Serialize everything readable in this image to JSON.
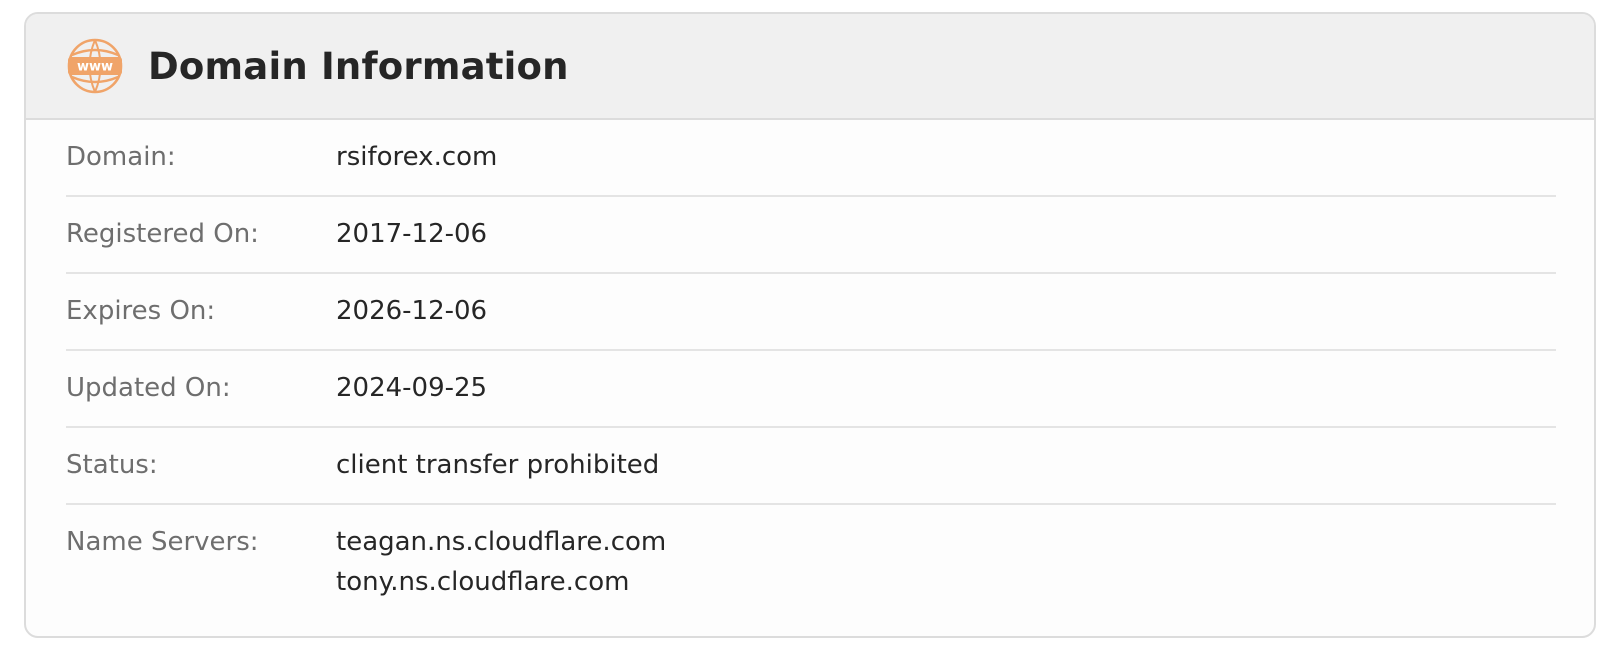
{
  "header": {
    "title": "Domain Information",
    "icon": "www-icon",
    "icon_text": "www",
    "icon_color": "#f0a469"
  },
  "rows": [
    {
      "label": "Domain:",
      "value": "rsiforex.com"
    },
    {
      "label": "Registered On:",
      "value": "2017-12-06"
    },
    {
      "label": "Expires On:",
      "value": "2026-12-06"
    },
    {
      "label": "Updated On:",
      "value": "2024-09-25"
    },
    {
      "label": "Status:",
      "value": "client transfer prohibited"
    },
    {
      "label": "Name Servers:",
      "values": [
        "teagan.ns.cloudflare.com",
        "tony.ns.cloudflare.com"
      ]
    }
  ]
}
